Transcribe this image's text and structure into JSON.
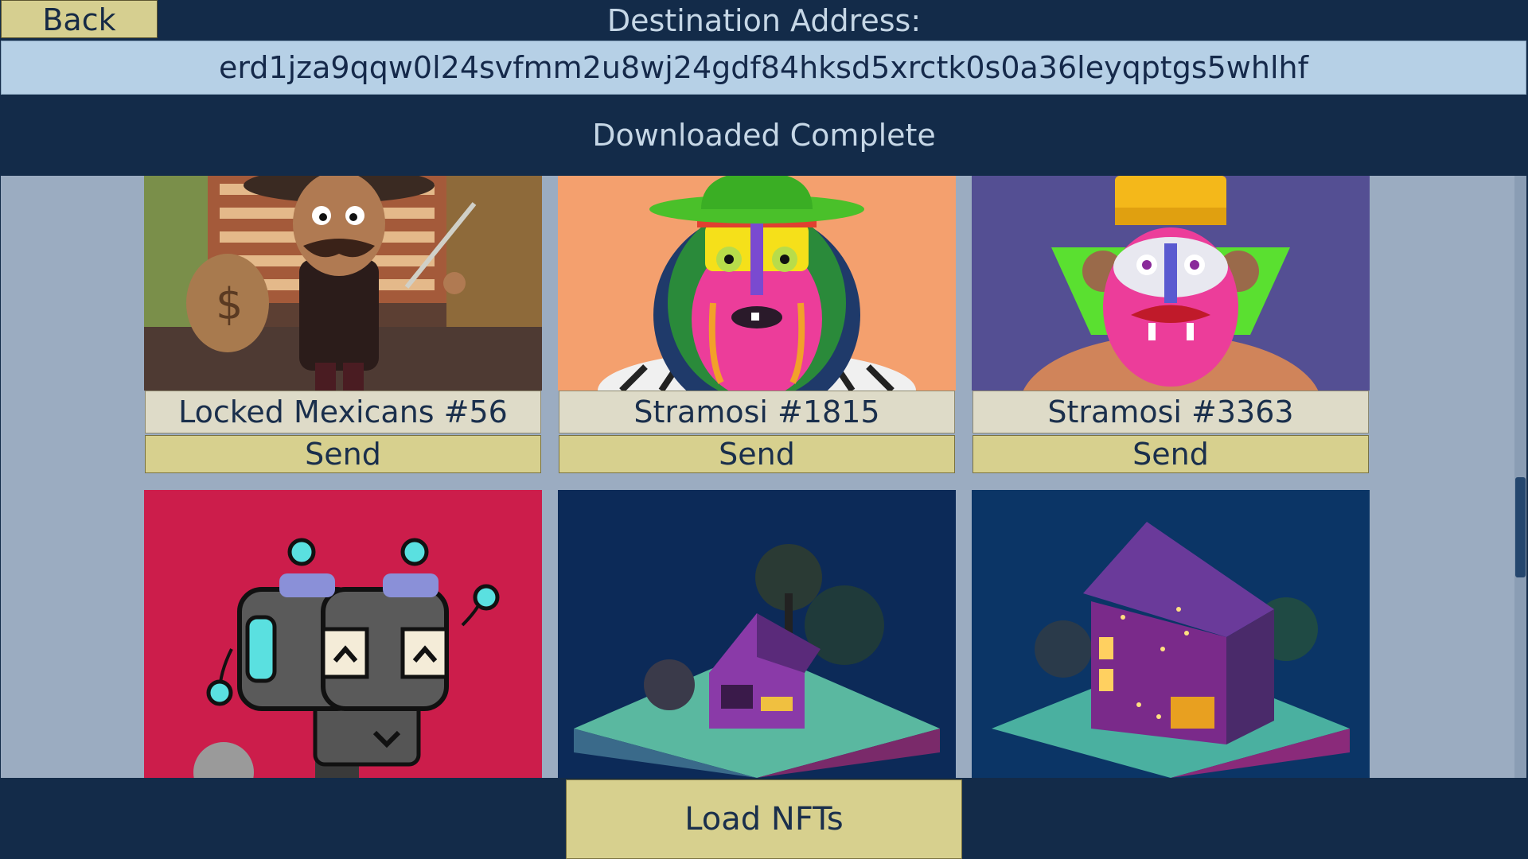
{
  "header": {
    "back_label": "Back",
    "destination_label": "Destination Address:",
    "destination_address": "erd1jza9qqw0l24svfmm2u8wj24gdf84hksd5xrctk0s0a36leyqptgs5whlhf"
  },
  "status": {
    "text": "Downloaded Complete"
  },
  "nfts": [
    {
      "name": "Locked Mexicans #56",
      "send_label": "Send",
      "image": "bandit-character-image"
    },
    {
      "name": "Stramosi #1815",
      "send_label": "Send",
      "image": "pink-monster-green-hat-image"
    },
    {
      "name": "Stramosi #3363",
      "send_label": "Send",
      "image": "pink-monster-yellow-hat-image"
    },
    {
      "name": "",
      "send_label": "",
      "image": "robot-binoculars-image"
    },
    {
      "name": "",
      "send_label": "",
      "image": "low-poly-house-image"
    },
    {
      "name": "",
      "send_label": "",
      "image": "low-poly-lit-house-image"
    }
  ],
  "scroll": {
    "position_fraction": 0.6
  },
  "footer": {
    "load_label": "Load NFTs"
  },
  "colors": {
    "background": "#132b49",
    "button": "#d7d08e",
    "address_field": "#b6d0e6",
    "scroll_view": "#9bacc1"
  }
}
